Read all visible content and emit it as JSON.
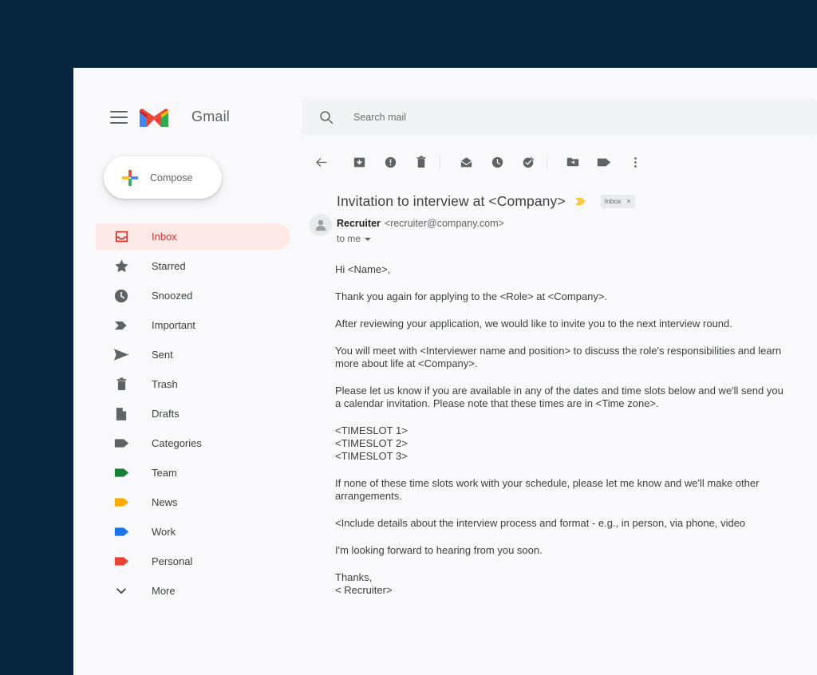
{
  "theme": {
    "page_background": "#06253F",
    "panel_background": "#F9F9FC",
    "accent_red": "#D93025",
    "inbox_highlight": "#FCE8E6",
    "search_background": "#F1F3F4"
  },
  "header": {
    "menu_icon": "hamburger-menu-icon",
    "logo_icon": "gmail-logo-icon",
    "brand_name": "Gmail",
    "search": {
      "icon": "search-icon",
      "placeholder": "Search mail",
      "value": ""
    }
  },
  "sidebar": {
    "compose": {
      "label": "Compose",
      "icon": "plus-icon"
    },
    "items": [
      {
        "label": "Inbox",
        "icon": "inbox-icon",
        "active": true,
        "color": "#D93025"
      },
      {
        "label": "Starred",
        "icon": "star-icon",
        "active": false,
        "color": "#5F6368"
      },
      {
        "label": "Snoozed",
        "icon": "clock-icon",
        "active": false,
        "color": "#5F6368"
      },
      {
        "label": "Important",
        "icon": "important-icon",
        "active": false,
        "color": "#5F6368"
      },
      {
        "label": "Sent",
        "icon": "send-icon",
        "active": false,
        "color": "#5F6368"
      },
      {
        "label": "Trash",
        "icon": "trash-icon",
        "active": false,
        "color": "#5F6368"
      },
      {
        "label": "Drafts",
        "icon": "drafts-icon",
        "active": false,
        "color": "#5F6368"
      },
      {
        "label": "Categories",
        "icon": "label-icon",
        "active": false,
        "color": "#5F6368"
      },
      {
        "label": "Team",
        "icon": "label-icon",
        "active": false,
        "color": "#188038"
      },
      {
        "label": "News",
        "icon": "label-icon",
        "active": false,
        "color": "#F9AB00"
      },
      {
        "label": "Work",
        "icon": "label-icon",
        "active": false,
        "color": "#1A73E8"
      },
      {
        "label": "Personal",
        "icon": "label-icon",
        "active": false,
        "color": "#EA4335"
      },
      {
        "label": "More",
        "icon": "chevron-down-icon",
        "active": false,
        "color": "#5F6368"
      }
    ]
  },
  "toolbar": {
    "buttons": [
      {
        "name": "back-button",
        "icon": "arrow-left-icon"
      },
      {
        "name": "archive-button",
        "icon": "archive-icon"
      },
      {
        "name": "report-spam-button",
        "icon": "report-spam-icon"
      },
      {
        "name": "delete-button",
        "icon": "trash-icon"
      },
      {
        "name": "mark-unread-button",
        "icon": "mail-unread-icon"
      },
      {
        "name": "snooze-button",
        "icon": "clock-icon"
      },
      {
        "name": "add-to-tasks-button",
        "icon": "add-to-tasks-icon"
      },
      {
        "name": "move-to-button",
        "icon": "folder-move-icon"
      },
      {
        "name": "labels-button",
        "icon": "label-icon"
      },
      {
        "name": "more-options-button",
        "icon": "more-vertical-icon"
      }
    ]
  },
  "email": {
    "subject": "Invitation to interview at <Company>",
    "important_marker_icon": "important-marker-icon",
    "label_chip": {
      "text": "Inbox",
      "close": "×"
    },
    "avatar_icon": "person-avatar-icon",
    "sender_name": "Recruiter",
    "sender_email": "<recruiter@company.com>",
    "recipient": "to me",
    "body": {
      "greeting": "Hi  <Name>,",
      "paragraph_1": "Thank you again for applying to the <Role> at <Company>.",
      "paragraph_2": "After reviewing your application, we would like to invite you to the next interview round.",
      "paragraph_3": "You will meet with <Interviewer name and position> to discuss the role's responsibilities and learn more about life at <Company>.",
      "paragraph_4": "Please let us know if you are available in any of the dates and time slots below and we'll send you a calendar invitation. Please note that these times are in <Time zone>.",
      "timeslot_1": "<TIMESLOT 1>",
      "timeslot_2": "<TIMESLOT 2>",
      "timeslot_3": "<TIMESLOT 3>",
      "paragraph_5": "If none of these time slots work with your schedule, please let me know and we'll make other arrangements.",
      "paragraph_6": "<Include details about the interview process and format - e.g., in person, via phone, video",
      "paragraph_7": "I'm looking forward to hearing from you soon.",
      "closing": "Thanks,",
      "signature": "< Recruiter>"
    }
  }
}
